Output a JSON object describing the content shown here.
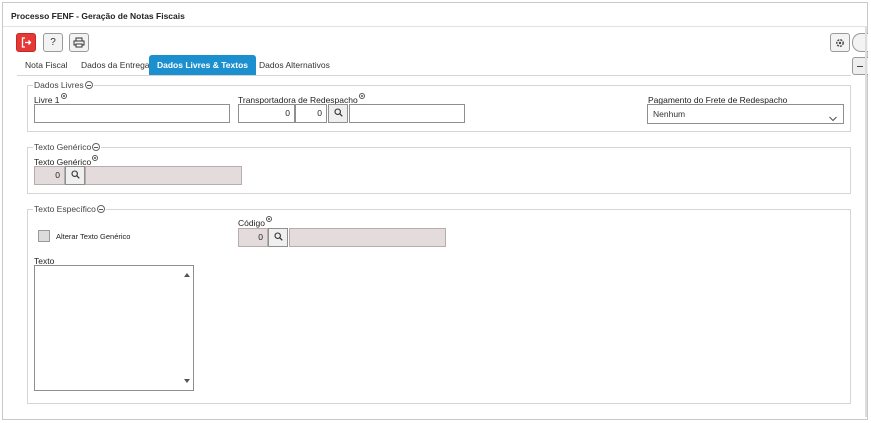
{
  "window": {
    "title": "Processo FENF - Geração de Notas Fiscais"
  },
  "toolbar": {
    "exit_icon": "exit-icon",
    "help_label": "?",
    "print_icon": "printer-icon",
    "settings_icon": "gear-icon"
  },
  "tabs": [
    {
      "label": "Nota Fiscal",
      "active": false
    },
    {
      "label": "Dados da Entrega",
      "active": false
    },
    {
      "label": "Dados Livres & Textos",
      "active": true
    },
    {
      "label": "Dados Alternativos",
      "active": false
    }
  ],
  "dados_livres": {
    "legend": "Dados Livres",
    "livre1": {
      "label": "Livre 1",
      "value": ""
    },
    "transportadora": {
      "label": "Transportadora de Redespacho",
      "value1": "0",
      "value2": "0",
      "name": ""
    },
    "pagamento_frete": {
      "label": "Pagamento do Frete de Redespacho",
      "selected": "Nenhum"
    }
  },
  "texto_generico": {
    "legend": "Texto Genérico",
    "field_label": "Texto Genérico",
    "code": "0",
    "description": ""
  },
  "texto_especifico": {
    "legend": "Texto Específico",
    "alterar_label": "Alterar Texto Genérico",
    "codigo_label": "Código",
    "codigo_value": "0",
    "codigo_description": "",
    "texto_label": "Texto",
    "texto_value": ""
  },
  "colors": {
    "active_tab": "#1c8fcf",
    "exit_button": "#e53935",
    "readonly_field": "#e4dcdc"
  }
}
